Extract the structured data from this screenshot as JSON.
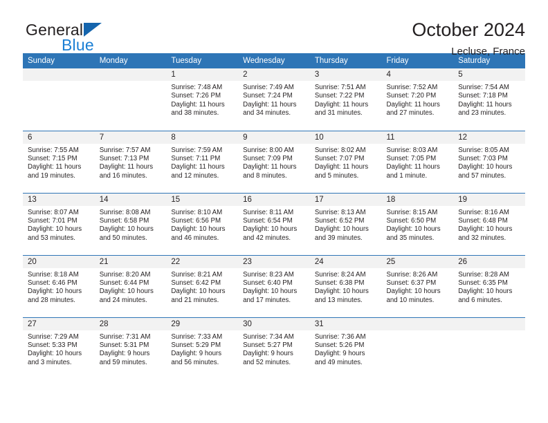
{
  "brand": {
    "name_top": "General",
    "name_bottom": "Blue",
    "triangle_color": "#1565ad",
    "blue_color": "#1b7fd4"
  },
  "header": {
    "title": "October 2024",
    "location": "Lecluse, France",
    "header_bg": "#2e75b6",
    "daynum_bg": "#f2f2f2"
  },
  "weekdays": [
    "Sunday",
    "Monday",
    "Tuesday",
    "Wednesday",
    "Thursday",
    "Friday",
    "Saturday"
  ],
  "labels": {
    "sunrise_prefix": "Sunrise:",
    "sunset_prefix": "Sunset:",
    "daylight_prefix": "Daylight:"
  },
  "weeks": [
    [
      {
        "day": "",
        "blank": true
      },
      {
        "day": "",
        "blank": true
      },
      {
        "day": "1",
        "sunrise": "Sunrise: 7:48 AM",
        "sunset": "Sunset: 7:26 PM",
        "daylight": "Daylight: 11 hours and 38 minutes."
      },
      {
        "day": "2",
        "sunrise": "Sunrise: 7:49 AM",
        "sunset": "Sunset: 7:24 PM",
        "daylight": "Daylight: 11 hours and 34 minutes."
      },
      {
        "day": "3",
        "sunrise": "Sunrise: 7:51 AM",
        "sunset": "Sunset: 7:22 PM",
        "daylight": "Daylight: 11 hours and 31 minutes."
      },
      {
        "day": "4",
        "sunrise": "Sunrise: 7:52 AM",
        "sunset": "Sunset: 7:20 PM",
        "daylight": "Daylight: 11 hours and 27 minutes."
      },
      {
        "day": "5",
        "sunrise": "Sunrise: 7:54 AM",
        "sunset": "Sunset: 7:18 PM",
        "daylight": "Daylight: 11 hours and 23 minutes."
      }
    ],
    [
      {
        "day": "6",
        "sunrise": "Sunrise: 7:55 AM",
        "sunset": "Sunset: 7:15 PM",
        "daylight": "Daylight: 11 hours and 19 minutes."
      },
      {
        "day": "7",
        "sunrise": "Sunrise: 7:57 AM",
        "sunset": "Sunset: 7:13 PM",
        "daylight": "Daylight: 11 hours and 16 minutes."
      },
      {
        "day": "8",
        "sunrise": "Sunrise: 7:59 AM",
        "sunset": "Sunset: 7:11 PM",
        "daylight": "Daylight: 11 hours and 12 minutes."
      },
      {
        "day": "9",
        "sunrise": "Sunrise: 8:00 AM",
        "sunset": "Sunset: 7:09 PM",
        "daylight": "Daylight: 11 hours and 8 minutes."
      },
      {
        "day": "10",
        "sunrise": "Sunrise: 8:02 AM",
        "sunset": "Sunset: 7:07 PM",
        "daylight": "Daylight: 11 hours and 5 minutes."
      },
      {
        "day": "11",
        "sunrise": "Sunrise: 8:03 AM",
        "sunset": "Sunset: 7:05 PM",
        "daylight": "Daylight: 11 hours and 1 minute."
      },
      {
        "day": "12",
        "sunrise": "Sunrise: 8:05 AM",
        "sunset": "Sunset: 7:03 PM",
        "daylight": "Daylight: 10 hours and 57 minutes."
      }
    ],
    [
      {
        "day": "13",
        "sunrise": "Sunrise: 8:07 AM",
        "sunset": "Sunset: 7:01 PM",
        "daylight": "Daylight: 10 hours and 53 minutes."
      },
      {
        "day": "14",
        "sunrise": "Sunrise: 8:08 AM",
        "sunset": "Sunset: 6:58 PM",
        "daylight": "Daylight: 10 hours and 50 minutes."
      },
      {
        "day": "15",
        "sunrise": "Sunrise: 8:10 AM",
        "sunset": "Sunset: 6:56 PM",
        "daylight": "Daylight: 10 hours and 46 minutes."
      },
      {
        "day": "16",
        "sunrise": "Sunrise: 8:11 AM",
        "sunset": "Sunset: 6:54 PM",
        "daylight": "Daylight: 10 hours and 42 minutes."
      },
      {
        "day": "17",
        "sunrise": "Sunrise: 8:13 AM",
        "sunset": "Sunset: 6:52 PM",
        "daylight": "Daylight: 10 hours and 39 minutes."
      },
      {
        "day": "18",
        "sunrise": "Sunrise: 8:15 AM",
        "sunset": "Sunset: 6:50 PM",
        "daylight": "Daylight: 10 hours and 35 minutes."
      },
      {
        "day": "19",
        "sunrise": "Sunrise: 8:16 AM",
        "sunset": "Sunset: 6:48 PM",
        "daylight": "Daylight: 10 hours and 32 minutes."
      }
    ],
    [
      {
        "day": "20",
        "sunrise": "Sunrise: 8:18 AM",
        "sunset": "Sunset: 6:46 PM",
        "daylight": "Daylight: 10 hours and 28 minutes."
      },
      {
        "day": "21",
        "sunrise": "Sunrise: 8:20 AM",
        "sunset": "Sunset: 6:44 PM",
        "daylight": "Daylight: 10 hours and 24 minutes."
      },
      {
        "day": "22",
        "sunrise": "Sunrise: 8:21 AM",
        "sunset": "Sunset: 6:42 PM",
        "daylight": "Daylight: 10 hours and 21 minutes."
      },
      {
        "day": "23",
        "sunrise": "Sunrise: 8:23 AM",
        "sunset": "Sunset: 6:40 PM",
        "daylight": "Daylight: 10 hours and 17 minutes."
      },
      {
        "day": "24",
        "sunrise": "Sunrise: 8:24 AM",
        "sunset": "Sunset: 6:38 PM",
        "daylight": "Daylight: 10 hours and 13 minutes."
      },
      {
        "day": "25",
        "sunrise": "Sunrise: 8:26 AM",
        "sunset": "Sunset: 6:37 PM",
        "daylight": "Daylight: 10 hours and 10 minutes."
      },
      {
        "day": "26",
        "sunrise": "Sunrise: 8:28 AM",
        "sunset": "Sunset: 6:35 PM",
        "daylight": "Daylight: 10 hours and 6 minutes."
      }
    ],
    [
      {
        "day": "27",
        "sunrise": "Sunrise: 7:29 AM",
        "sunset": "Sunset: 5:33 PM",
        "daylight": "Daylight: 10 hours and 3 minutes."
      },
      {
        "day": "28",
        "sunrise": "Sunrise: 7:31 AM",
        "sunset": "Sunset: 5:31 PM",
        "daylight": "Daylight: 9 hours and 59 minutes."
      },
      {
        "day": "29",
        "sunrise": "Sunrise: 7:33 AM",
        "sunset": "Sunset: 5:29 PM",
        "daylight": "Daylight: 9 hours and 56 minutes."
      },
      {
        "day": "30",
        "sunrise": "Sunrise: 7:34 AM",
        "sunset": "Sunset: 5:27 PM",
        "daylight": "Daylight: 9 hours and 52 minutes."
      },
      {
        "day": "31",
        "sunrise": "Sunrise: 7:36 AM",
        "sunset": "Sunset: 5:26 PM",
        "daylight": "Daylight: 9 hours and 49 minutes."
      },
      {
        "day": "",
        "blank": true
      },
      {
        "day": "",
        "blank": true
      }
    ]
  ]
}
